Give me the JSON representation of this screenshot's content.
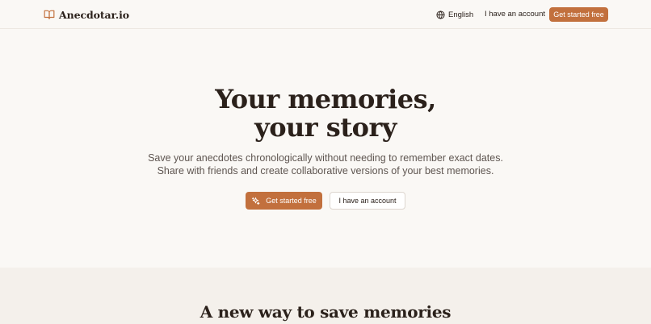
{
  "header": {
    "brand": "Anecdotar.io",
    "brand_icon": "open-book-icon",
    "language_icon": "globe-icon",
    "language": "English",
    "login": "I have an account",
    "cta": "Get started free"
  },
  "hero": {
    "title_line1": "Your memories,",
    "title_line2": "your story",
    "subtitle_line1": "Save your anecdotes chronologically without needing to remember exact dates.",
    "subtitle_line2": "Share with friends and create collaborative versions of your best memories.",
    "primary_cta": "Get started free",
    "primary_cta_icon": "sparkles-icon",
    "secondary_cta": "I have an account"
  },
  "section": {
    "title": "A new way to save memories"
  },
  "colors": {
    "accent": "#c2703d",
    "background": "#faf8f5",
    "band": "#f4f0eb",
    "text": "#2b211b"
  }
}
